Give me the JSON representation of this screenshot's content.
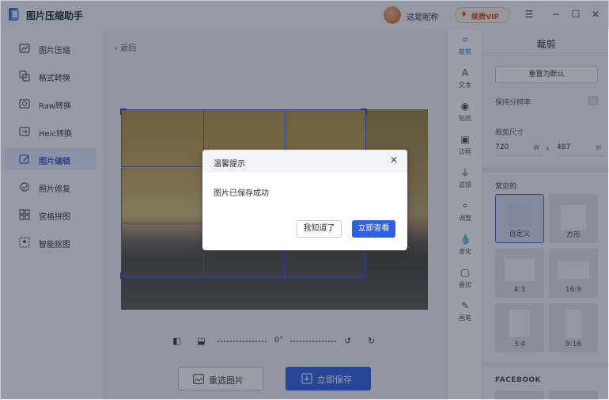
{
  "app": {
    "title": "图片压缩助手",
    "nickname": "这是昵称",
    "vip_label": "续费VIP"
  },
  "window": {
    "menu_icon": "menu-icon",
    "minimize_icon": "minimize-icon",
    "maximize_icon": "maximize-icon",
    "close_icon": "close-icon"
  },
  "sidebar": {
    "items": [
      {
        "label": "图片压缩",
        "icon": "compress-icon"
      },
      {
        "label": "格式转换",
        "icon": "convert-icon"
      },
      {
        "label": "Raw转换",
        "icon": "raw-icon"
      },
      {
        "label": "Heic转换",
        "icon": "heic-icon"
      },
      {
        "label": "图片编辑",
        "icon": "edit-icon",
        "active": true
      },
      {
        "label": "照片修复",
        "icon": "repair-icon"
      },
      {
        "label": "宫格拼图",
        "icon": "grid-icon"
      },
      {
        "label": "智能抠图",
        "icon": "cutout-icon"
      }
    ]
  },
  "main": {
    "back_label": "返回",
    "rotation": "0°",
    "reselect_label": "重选图片",
    "save_label": "立即保存"
  },
  "tools": [
    {
      "label": "裁剪",
      "icon": "crop-icon",
      "active": true
    },
    {
      "label": "文本",
      "icon": "text-icon"
    },
    {
      "label": "贴纸",
      "icon": "sticker-icon"
    },
    {
      "label": "边框",
      "icon": "border-icon"
    },
    {
      "label": "滤镜",
      "icon": "filter-icon"
    },
    {
      "label": "调整",
      "icon": "adjust-icon"
    },
    {
      "label": "虚化",
      "icon": "blur-icon"
    },
    {
      "label": "叠加",
      "icon": "overlay-icon"
    },
    {
      "label": "画笔",
      "icon": "brush-icon"
    }
  ],
  "panel": {
    "title": "裁剪",
    "reset_label": "重置为默认",
    "keep_resolution_label": "保持分辨率",
    "size_label": "裁剪尺寸",
    "width": "720",
    "width_unit": "W",
    "height": "487",
    "height_unit": "H",
    "times": "x",
    "common_label": "常见的",
    "ratios": [
      {
        "label": "自定义",
        "active": true
      },
      {
        "label": "方形"
      },
      {
        "label": "4:3"
      },
      {
        "label": "16:9"
      },
      {
        "label": "3:4"
      },
      {
        "label": "9:16"
      }
    ],
    "facebook_label": "FACEBOOK"
  },
  "dialog": {
    "title": "温馨提示",
    "message": "图片已保存成功",
    "ok_label": "我知道了",
    "view_label": "立即查看"
  }
}
